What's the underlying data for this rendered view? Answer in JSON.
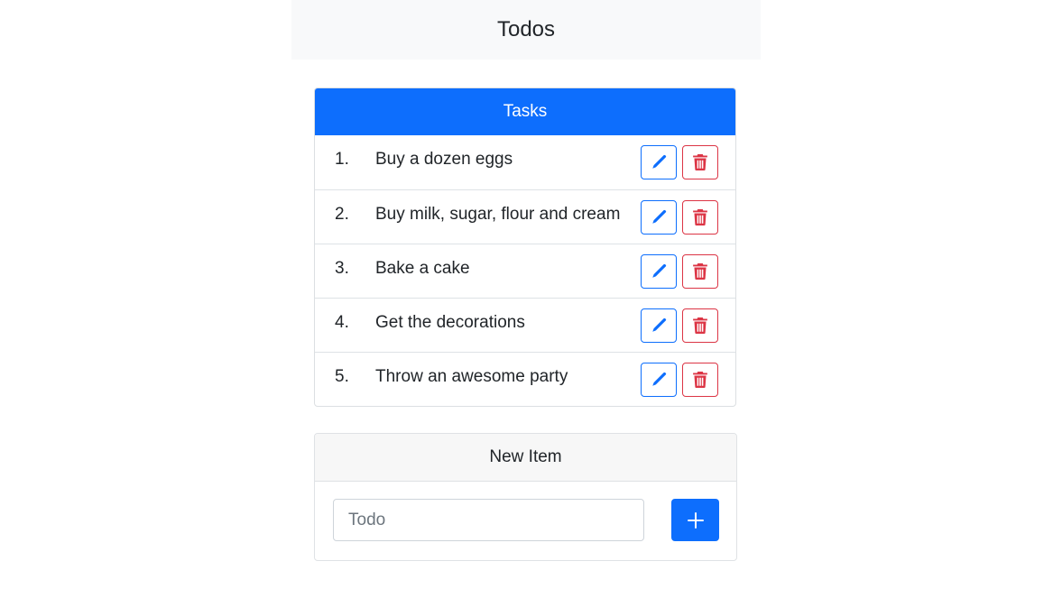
{
  "header": {
    "title": "Todos"
  },
  "tasks_card": {
    "title": "Tasks",
    "items": [
      {
        "number": "1.",
        "text": "Buy a dozen eggs"
      },
      {
        "number": "2.",
        "text": "Buy milk, sugar, flour and cream"
      },
      {
        "number": "3.",
        "text": "Bake a cake"
      },
      {
        "number": "4.",
        "text": "Get the decorations"
      },
      {
        "number": "5.",
        "text": "Throw an awesome party"
      }
    ],
    "edit_icon": "pencil-icon",
    "delete_icon": "trash-icon"
  },
  "new_item": {
    "title": "New Item",
    "input_value": "",
    "input_placeholder": "Todo",
    "add_icon": "plus-icon"
  },
  "colors": {
    "primary": "#0d6efd",
    "danger": "#dc3545",
    "header_bg": "#f8f9fa",
    "card_header_bg": "#f7f7f7"
  }
}
